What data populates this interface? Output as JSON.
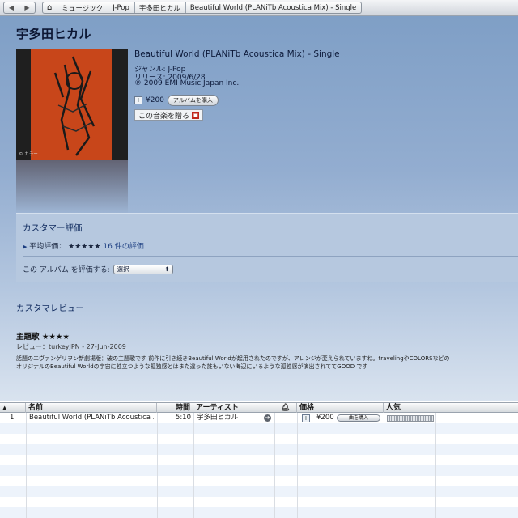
{
  "nav": {
    "back_icon": "back-arrow-icon",
    "forward_icon": "forward-arrow-icon",
    "breadcrumbs": [
      "ミュージック",
      "J-Pop",
      "宇多田ヒカル",
      "Beautiful World (PLANiTb Acoustica Mix) - Single"
    ]
  },
  "album": {
    "artist": "宇多田ヒカル",
    "title": "Beautiful World (PLANiTb Acoustica Mix) - Single",
    "genre": "ジャンル: J-Pop",
    "release": "リリース: 2009/6/28",
    "copyright": "℗ 2009 EMI Music Japan Inc.",
    "price": "¥200",
    "buy_album_label": "アルバムを購入",
    "gift_label": "この音楽を贈る",
    "cover_text": "© カラー"
  },
  "ratings": {
    "title": "カスタマー評価",
    "avg_label": "平均評価：",
    "avg_stars": "★★★★★",
    "avg_count": "16 件の評価",
    "rate_label": "この アルバム を評価する:",
    "rate_select": "選択"
  },
  "reviews": {
    "title": "カスタマレビュー",
    "item": {
      "heading": "主題歌",
      "stars": "★★★★",
      "meta": "レビュー：turkeyJPN - 27-Jun-2009",
      "line1": "話題のエヴァンゲリヲン新劇場版：破の主題歌です 前作に引き続きBeautiful Worldが起用されたのですが、アレンジが変えられていますね。travelingやCOLORSなどの",
      "line2": "オリジナルのBeautiful Worldの宇宙に独立つような孤独感とはまた違った誰もいない海辺にいるような孤独感が演出されててGOOD です"
    }
  },
  "tracklist": {
    "headers": {
      "num": "",
      "name": "名前",
      "time": "時間",
      "artist": "アーティスト",
      "price": "価格",
      "popularity": "人気"
    },
    "rows": [
      {
        "num": "1",
        "name": "Beautiful World (PLANiTb Acoustica ...",
        "time": "5:10",
        "artist": "宇多田ヒカル",
        "price": "¥200",
        "buy_label": "曲を購入",
        "popularity": 1.0
      }
    ]
  },
  "colors": {
    "store_bg_top": "#7f9fc6",
    "panel_bg": "#b6c8df",
    "link_blue": "#0f2a5e"
  }
}
